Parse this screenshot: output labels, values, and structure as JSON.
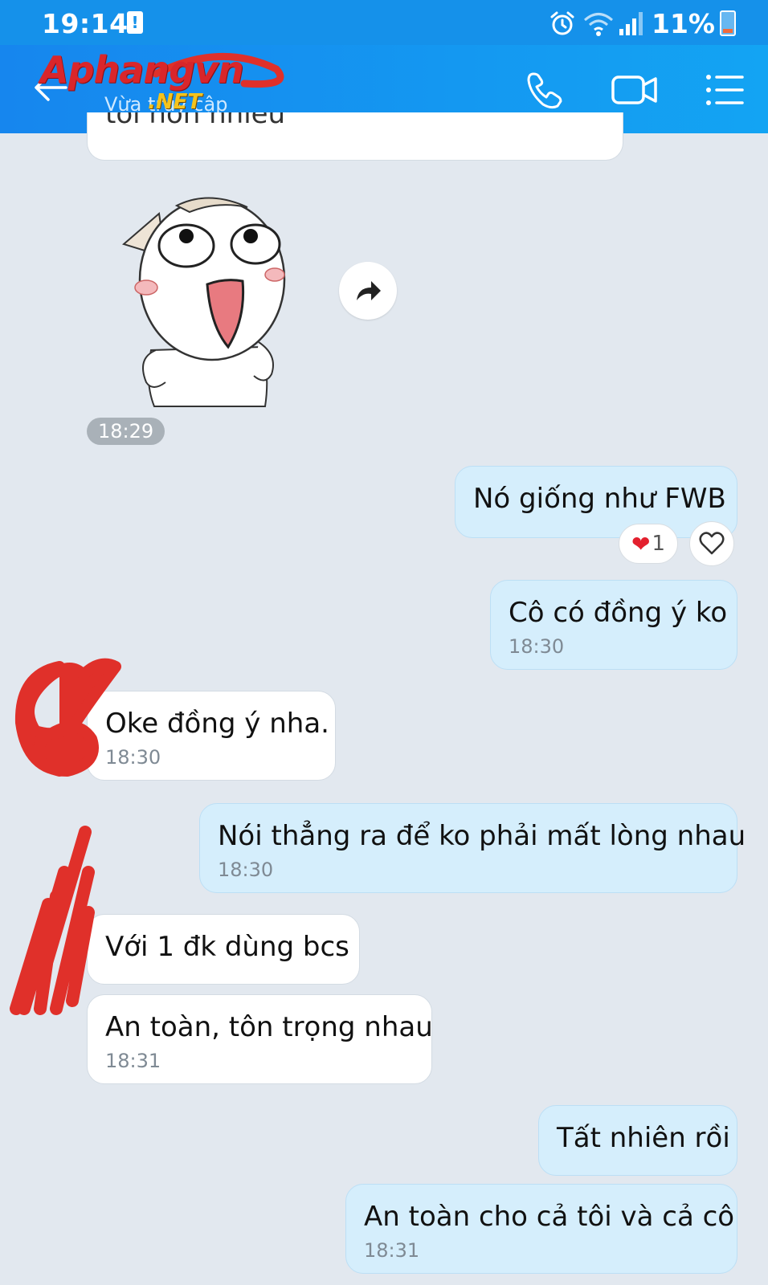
{
  "status_bar": {
    "time": "19:14",
    "battery": "11%"
  },
  "header": {
    "logo_main": "Aphangvn",
    "logo_suffix": ".NET",
    "subtitle": "Vừa truy cập"
  },
  "messages": [
    {
      "id": "partial",
      "side": "them",
      "text": "tôi hơn nhiều"
    },
    {
      "id": "sticker",
      "side": "them",
      "time": "18:29"
    },
    {
      "id": "m1",
      "side": "me",
      "text": "Nó giống như FWB",
      "reactions": {
        "emoji": "❤",
        "count": "1"
      }
    },
    {
      "id": "m2",
      "side": "me",
      "text": "Cô có đồng ý ko",
      "time": "18:30"
    },
    {
      "id": "m3",
      "side": "them",
      "text": "Oke đồng ý nha.",
      "time": "18:30"
    },
    {
      "id": "m4",
      "side": "me",
      "text": "Nói thẳng ra để ko phải mất lòng nhau",
      "time": "18:30"
    },
    {
      "id": "m5",
      "side": "them",
      "text": "Với 1 đk dùng bcs"
    },
    {
      "id": "m6",
      "side": "them",
      "text": "An toàn, tôn trọng nhau",
      "time": "18:31"
    },
    {
      "id": "m7",
      "side": "me",
      "text": "Tất nhiên rồi"
    },
    {
      "id": "m8",
      "side": "me",
      "text": "An toàn cho cả tôi và cả cô",
      "time": "18:31"
    }
  ],
  "colors": {
    "status_bar": "#1591ea",
    "header_from": "#1686ee",
    "header_to": "#13a4f3",
    "chat_bg": "#e2e8ef",
    "my_bubble": "#d5eefc",
    "their_bubble": "#ffffff",
    "redaction": "#e0302a"
  }
}
